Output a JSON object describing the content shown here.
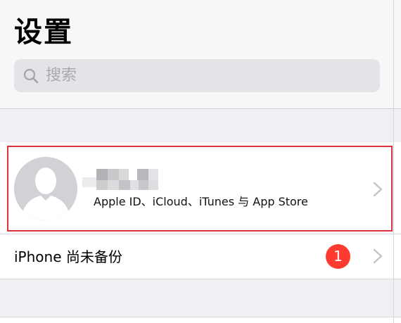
{
  "header": {
    "title": "设置",
    "search_placeholder": "搜索"
  },
  "profile": {
    "name": "",
    "subtitle": "Apple ID、iCloud、iTunes 与 App Store",
    "highlight_color": "#e0323a"
  },
  "backup_row": {
    "label": "iPhone 尚未备份",
    "badge_count": "1",
    "badge_color": "#ff3b30"
  },
  "icons": [
    "search-icon",
    "avatar-placeholder-icon",
    "chevron-right-icon"
  ]
}
